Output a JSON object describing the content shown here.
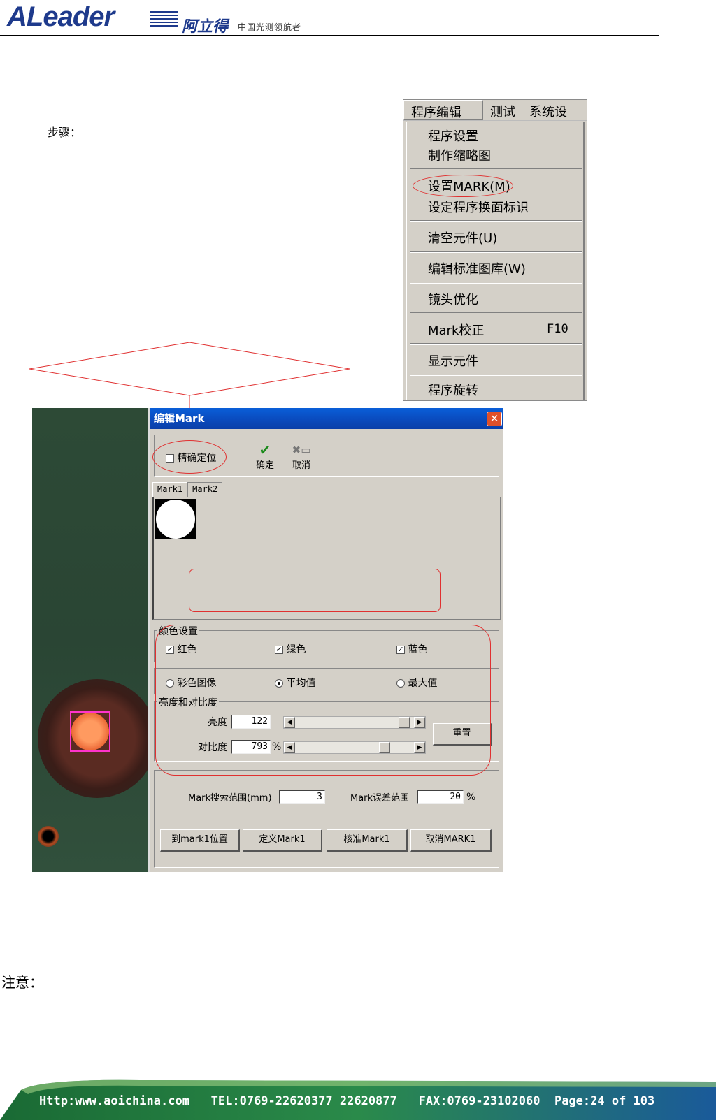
{
  "header": {
    "logo_text": "ALeader",
    "logo_cn": "阿立得",
    "slogan": "中国光测领航者"
  },
  "steps_label": "步骤：",
  "menu": {
    "bar": [
      "程序编辑",
      "测试",
      "系统设"
    ],
    "items": {
      "program_settings": "程序设置",
      "make_thumbnail": "制作缩略图",
      "set_mark": "设置MARK(M)",
      "set_side_mark": "设定程序换面标识",
      "clear_parts": "清空元件(U)",
      "edit_library": "编辑标准图库(W)",
      "lens_optimize": "镜头优化",
      "mark_calibrate": "Mark校正",
      "mark_calibrate_key": "F10",
      "show_parts": "显示元件",
      "rotate_program": "程序旋转"
    }
  },
  "dialog": {
    "title": "编辑Mark",
    "close": "✕",
    "precise_label": "精确定位",
    "ok_label": "确定",
    "cancel_label": "取消",
    "tabs": [
      "Mark1",
      "Mark2"
    ],
    "color_group": "颜色设置",
    "red": "红色",
    "green": "绿色",
    "blue": "蓝色",
    "color_image": "彩色图像",
    "average": "平均值",
    "max_value": "最大值",
    "bc_group": "亮度和对比度",
    "brightness_label": "亮度",
    "brightness_value": "122",
    "contrast_label": "对比度",
    "contrast_value": "793",
    "percent": "%",
    "reset": "重置",
    "search_range_label": "Mark搜索范围(mm)",
    "search_range_value": "3",
    "error_range_label": "Mark误差范围",
    "error_range_value": "20",
    "goto_mark1": "到mark1位置",
    "define_mark1": "定义Mark1",
    "verify_mark1": "核准Mark1",
    "cancel_mark1": "取消MARK1"
  },
  "note_label": "注意：",
  "footer": {
    "url": "Http:www.aoichina.com",
    "tel": "TEL:0769-22620377 22620877",
    "fax": "FAX:0769-23102060",
    "page": "Page:24 of 103"
  },
  "colors": {
    "brand_blue": "#1e3a8c",
    "annotation_red": "#e03030",
    "footer_green": "#1f7a3a",
    "titlebar_blue": "#0a4cc0"
  }
}
